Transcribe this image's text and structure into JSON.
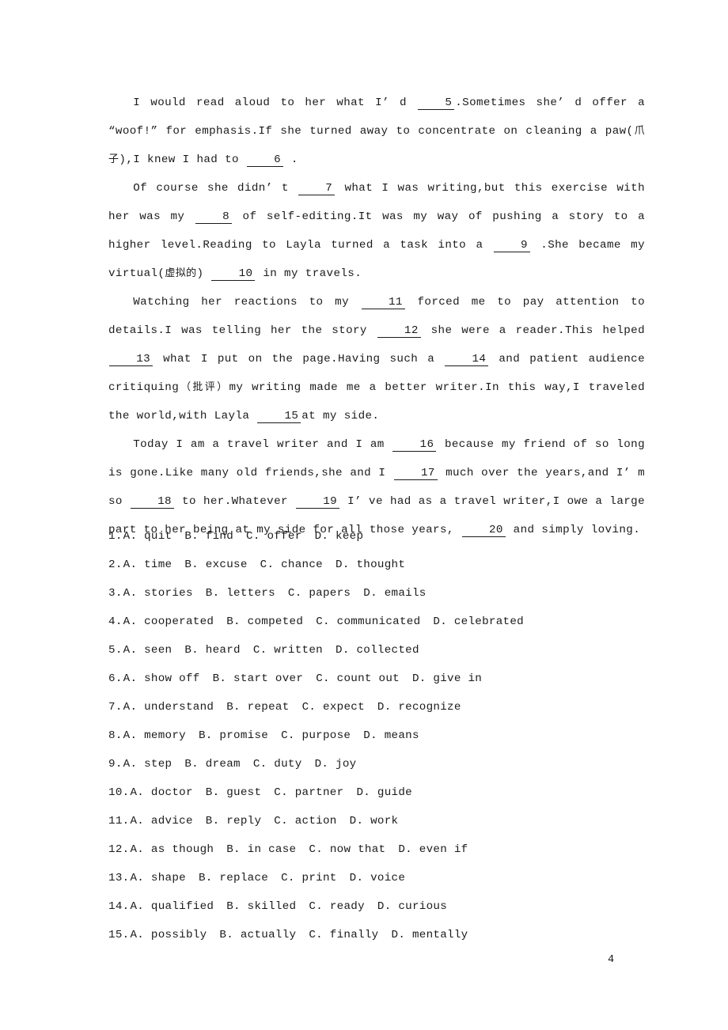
{
  "document": {
    "page_number": "4",
    "type": "cloze-test-worksheet"
  },
  "passage": {
    "paragraphs": [
      {
        "id": "p1",
        "segments": [
          {
            "t": "text",
            "v": "I would read aloud to her what I’ d "
          },
          {
            "t": "blank",
            "v": "5"
          },
          {
            "t": "text",
            "v": ".Sometimes she’ d offer a “woof!” for emphasis.If she turned away to concentrate on cleaning a paw(爪子),I knew I had to "
          },
          {
            "t": "blank",
            "v": "6"
          },
          {
            "t": "text",
            "v": " ."
          }
        ]
      },
      {
        "id": "p2",
        "segments": [
          {
            "t": "text",
            "v": "Of course she didn’ t "
          },
          {
            "t": "blank",
            "v": "7"
          },
          {
            "t": "text",
            "v": " what I was writing,but this exercise with her was my "
          },
          {
            "t": "blank",
            "v": "8"
          },
          {
            "t": "text",
            "v": " of self-editing.It was my way of pushing a story to a higher level.Reading to Layla turned a task into a "
          },
          {
            "t": "blank",
            "v": "9"
          },
          {
            "t": "text",
            "v": " .She became my virtual(虚拟的) "
          },
          {
            "t": "blank",
            "v": "10"
          },
          {
            "t": "text",
            "v": " in my travels."
          }
        ]
      },
      {
        "id": "p3",
        "segments": [
          {
            "t": "text",
            "v": "Watching her reactions to my "
          },
          {
            "t": "blank",
            "v": "11"
          },
          {
            "t": "text",
            "v": " forced me to pay attention to details.I was telling her the story "
          },
          {
            "t": "blank",
            "v": "12"
          },
          {
            "t": "text",
            "v": " she were a reader.This helped "
          },
          {
            "t": "blank",
            "v": "13"
          },
          {
            "t": "text",
            "v": " what I put on the page.Having such a "
          },
          {
            "t": "blank",
            "v": "14"
          },
          {
            "t": "text",
            "v": " and patient audience critiquing（批评）my writing made me a better writer.In this way,I traveled the world,with Layla "
          },
          {
            "t": "blank",
            "v": "15"
          },
          {
            "t": "text",
            "v": "at my side."
          }
        ]
      },
      {
        "id": "p4",
        "segments": [
          {
            "t": "text",
            "v": "Today I am a travel writer and I am "
          },
          {
            "t": "blank",
            "v": "16"
          },
          {
            "t": "text",
            "v": " because my friend of so long is gone.Like many old friends,she and I "
          },
          {
            "t": "blank",
            "v": "17"
          },
          {
            "t": "text",
            "v": " much over the years,and I’ m so "
          },
          {
            "t": "blank",
            "v": "18"
          },
          {
            "t": "text",
            "v": " to her.Whatever "
          },
          {
            "t": "blank",
            "v": "19"
          },
          {
            "t": "text",
            "v": " I’ ve had as a travel writer,I owe a large part to her being at my side for all those years, "
          },
          {
            "t": "blank",
            "v": "20"
          },
          {
            "t": "text",
            "v": " and simply loving."
          }
        ]
      }
    ]
  },
  "options": {
    "questions": [
      {
        "num": "1.",
        "choices": [
          "A. quit",
          "B. find",
          "C. offer",
          "D. keep"
        ]
      },
      {
        "num": "2.",
        "choices": [
          "A. time",
          "B. excuse",
          "C. chance",
          "D. thought"
        ]
      },
      {
        "num": "3.",
        "choices": [
          "A. stories",
          "B. letters",
          "C. papers",
          "D. emails"
        ]
      },
      {
        "num": "4.",
        "choices": [
          "A. cooperated",
          "B. competed",
          "C. communicated",
          "D. celebrated"
        ]
      },
      {
        "num": "5.",
        "choices": [
          "A. seen",
          "B. heard",
          "C. written",
          "D. collected"
        ]
      },
      {
        "num": "6.",
        "choices": [
          "A. show off",
          "B. start over",
          "C. count out",
          "D. give in"
        ]
      },
      {
        "num": "7.",
        "choices": [
          "A. understand",
          "B. repeat",
          "C. expect",
          "D. recognize"
        ]
      },
      {
        "num": "8.",
        "choices": [
          "A. memory",
          "B. promise",
          "C. purpose",
          "D. means"
        ]
      },
      {
        "num": "9.",
        "choices": [
          "A. step",
          "B. dream",
          "C. duty",
          "D. joy"
        ]
      },
      {
        "num": "10.",
        "choices": [
          "A. doctor",
          "B. guest",
          "C. partner",
          "D. guide"
        ]
      },
      {
        "num": "11.",
        "choices": [
          "A. advice",
          "B. reply",
          "C. action",
          "D. work"
        ]
      },
      {
        "num": "12.",
        "choices": [
          "A. as though",
          "B. in case",
          "C. now that",
          "D. even if"
        ]
      },
      {
        "num": "13.",
        "choices": [
          "A. shape",
          "B. replace",
          "C. print",
          "D. voice"
        ]
      },
      {
        "num": "14.",
        "choices": [
          "A. qualified",
          "B. skilled",
          "C. ready",
          "D. curious"
        ]
      },
      {
        "num": "15.",
        "choices": [
          "A. possibly",
          "B. actually",
          "C. finally",
          "D. mentally"
        ]
      }
    ]
  }
}
